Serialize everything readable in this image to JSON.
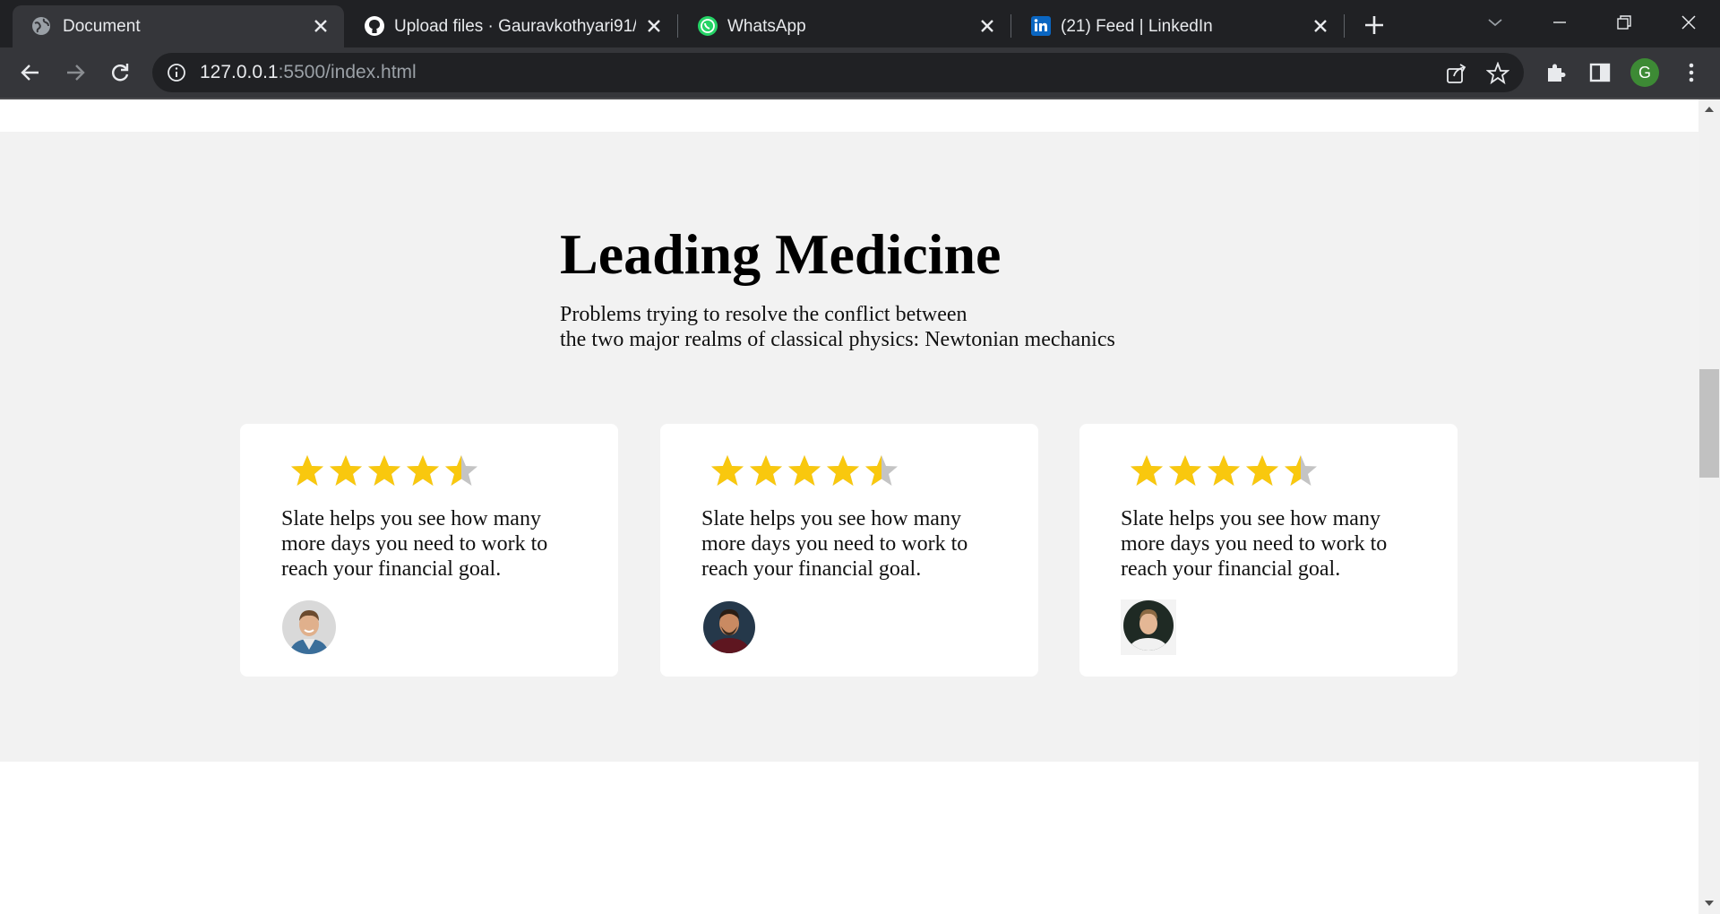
{
  "browser": {
    "tabs": [
      {
        "title": "Document",
        "icon": "globe-icon",
        "active": true
      },
      {
        "title": "Upload files · Gauravkothyari91/I",
        "icon": "github-icon",
        "active": false
      },
      {
        "title": "WhatsApp",
        "icon": "whatsapp-icon",
        "active": false
      },
      {
        "title": "(21) Feed | LinkedIn",
        "icon": "linkedin-icon",
        "active": false
      }
    ],
    "url_host": "127.0.0.1",
    "url_path": ":5500/index.html",
    "profile_initial": "G"
  },
  "page": {
    "heading": "Leading Medicine",
    "subtext_line1": "Problems trying to resolve the conflict between",
    "subtext_line2": "the two major realms of classical physics: Newtonian mechanics",
    "testimonials": [
      {
        "rating": 4.5,
        "quote": "Slate helps you see how many more days you need to work to reach your financial goal.",
        "avatar": "person-avatar-1"
      },
      {
        "rating": 4.5,
        "quote": "Slate helps you see how many more days you need to work to reach your financial goal.",
        "avatar": "person-avatar-2"
      },
      {
        "rating": 4.5,
        "quote": "Slate helps you see how many more days you need to work to reach your financial goal.",
        "avatar": "person-avatar-3"
      }
    ]
  },
  "colors": {
    "star": "#f9c80e",
    "star_empty": "#c4c4c4",
    "section_bg": "#f2f2f2",
    "chrome_dark": "#202124"
  }
}
